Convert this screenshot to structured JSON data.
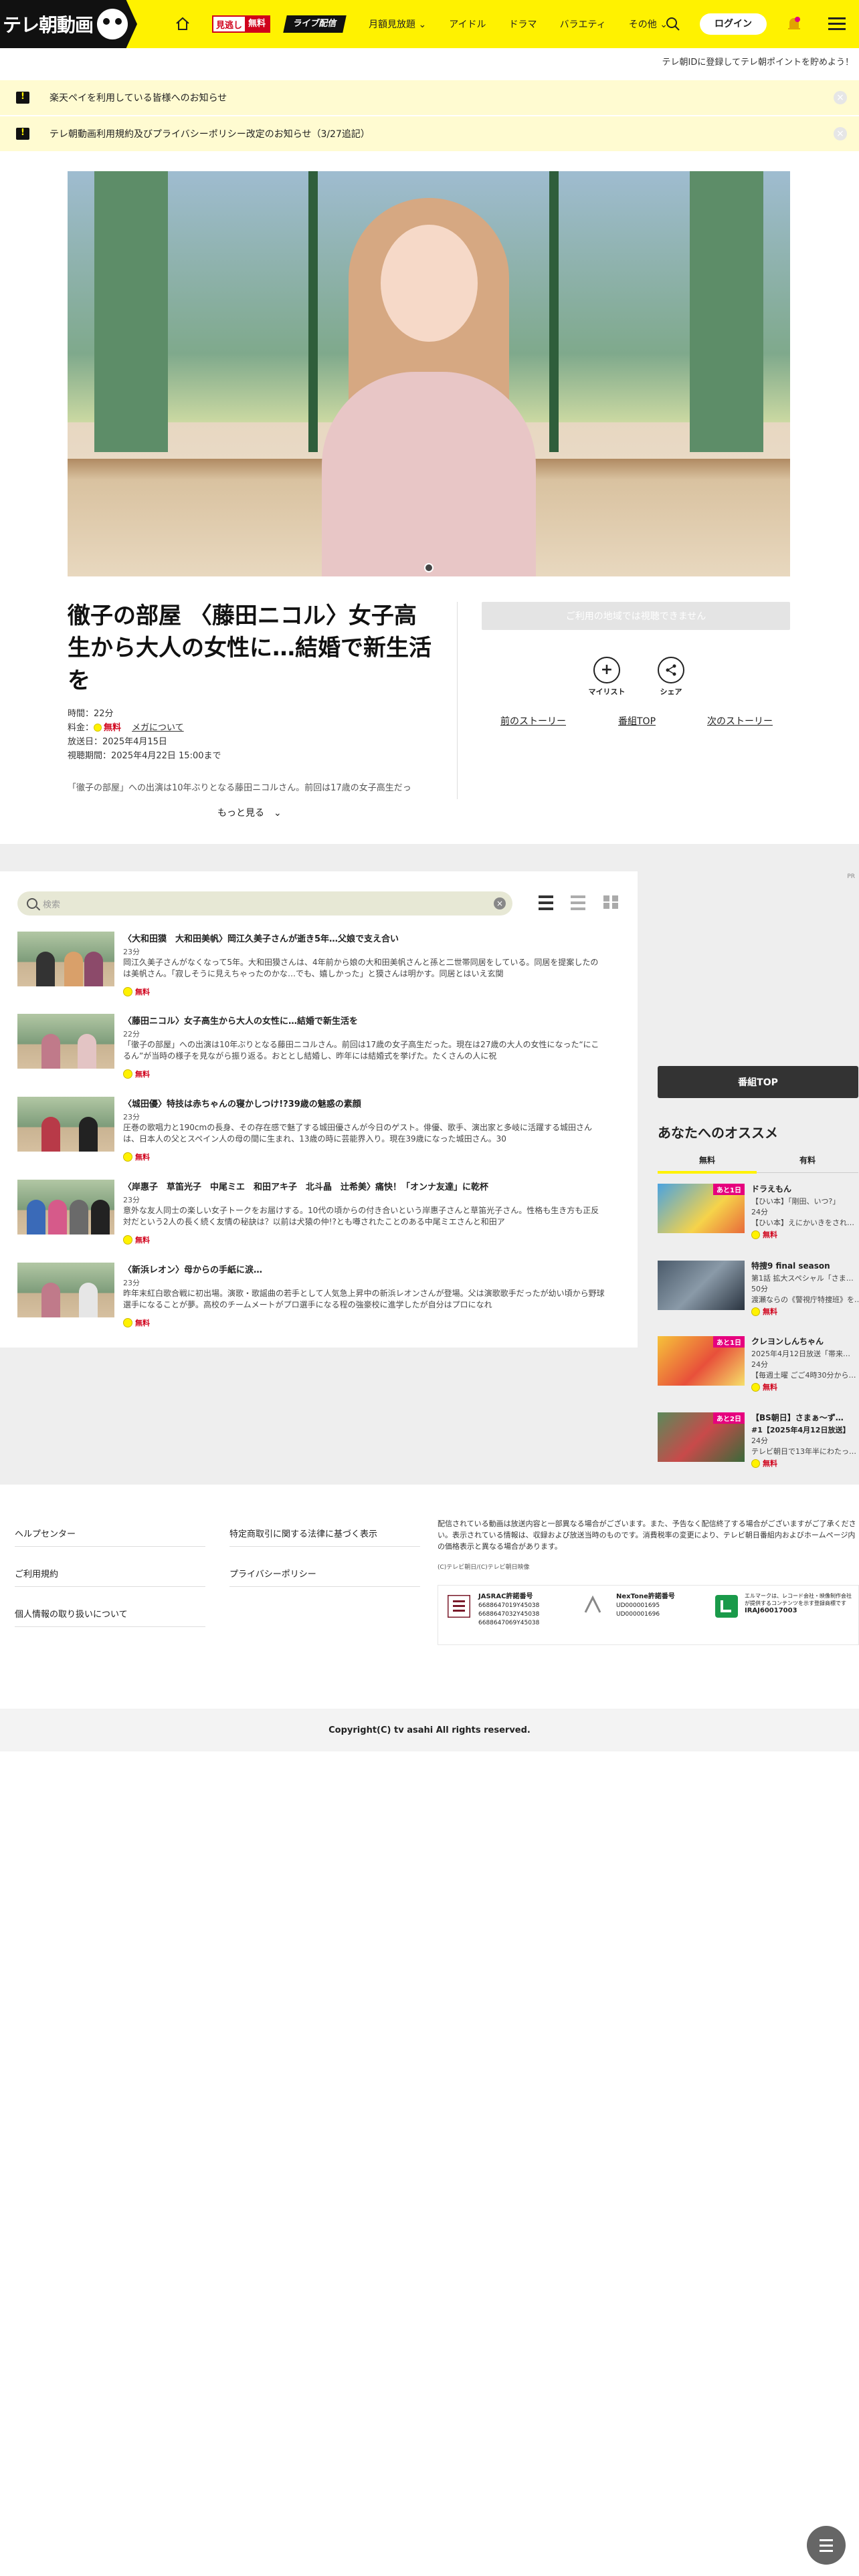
{
  "header": {
    "logo_text": "テレ朝動画",
    "badge_mitoshi": "見逃し",
    "badge_free": "無料",
    "badge_live": "ライブ配信",
    "nav": [
      "月額見放題",
      "アイドル",
      "ドラマ",
      "バラエティ",
      "その他"
    ],
    "login_label": "ログイン",
    "colors": {
      "accent": "#fff200",
      "free": "#d0021b",
      "pink": "#e6007e"
    }
  },
  "promo_text": "テレ朝IDに登録してテレ朝ポイントを貯めよう！",
  "notices": [
    "楽天ペイを利用している皆様へのお知らせ",
    "テレ朝動画利用規約及びプライバシーポリシー改定のお知らせ（3/27追記）"
  ],
  "program": {
    "title": "徹子の部屋 〈藤田ニコル〉女子高生から大人の女性に…結婚で新生活を",
    "duration": "時間：22分",
    "price_label": "料金：",
    "price_value": "無料",
    "menu_link": "メガについて",
    "air_date": "放送日：2025年4月15日",
    "period": "視聴期間：2025年4月22日 15:00まで",
    "description": "「徹子の部屋」への出演は10年ぶりとなる藤田ニコルさん。前回は17歳の女子高生だっ",
    "more_label": "もっと見る",
    "unavailable": "ご利用の地域では視聴できません",
    "mylist_label": "マイリスト",
    "share_label": "シェア",
    "prev_story": "前のストーリー",
    "program_top": "番組TOP",
    "next_story": "次のストーリー"
  },
  "list": {
    "search_placeholder": "検索",
    "episodes": [
      {
        "title": "〈大和田獏　大和田美帆〉岡江久美子さんが逝き5年…父娘で支え合い",
        "duration": "23分",
        "desc": "岡江久美子さんがなくなって5年。大和田獏さんは、4年前から娘の大和田美帆さんと孫と二世帯同居をしている。同居を提案したのは美帆さん。「寂しそうに見えちゃったのかな…でも、嬉しかった」と獏さんは明かす。同居とはいえ玄関",
        "free": "無料"
      },
      {
        "title": "〈藤田ニコル〉女子高生から大人の女性に…結婚で新生活を",
        "duration": "22分",
        "desc": "「徹子の部屋」への出演は10年ぶりとなる藤田ニコルさん。前回は17歳の女子高生だった。現在は27歳の大人の女性になった“にこるん”が当時の様子を見ながら振り返る。おととし結婚し、昨年には結婚式を挙げた。たくさんの人に祝",
        "free": "無料"
      },
      {
        "title": "〈城田優〉特技は赤ちゃんの寝かしつけ!?39歳の魅惑の素顔",
        "duration": "23分",
        "desc": "圧巻の歌唱力と190cmの長身、その存在感で魅了する城田優さんが今日のゲスト。俳優、歌手、演出家と多岐に活躍する城田さんは、日本人の父とスペイン人の母の間に生まれ、13歳の時に芸能界入り。現在39歳になった城田さん。30",
        "free": "無料"
      },
      {
        "title": "〈岸惠子　草笛光子　中尾ミエ　和田アキ子　北斗晶　辻希美〉痛快！「オンナ友達」に乾杯",
        "duration": "23分",
        "desc": "意外な友人同士の楽しい女子トークをお届けする。10代の頃からの付き合いという岸惠子さんと草笛光子さん。性格も生き方も正反対だという2人の長く続く友情の秘訣は？以前は犬猿の仲!?とも噂されたことのある中尾ミエさんと和田ア",
        "free": "無料"
      },
      {
        "title": "〈新浜レオン〉母からの手紙に涙…",
        "duration": "23分",
        "desc": "昨年末紅白歌合戦に初出場。演歌・歌謡曲の若手として人気急上昇中の新浜レオンさんが登場。父は演歌歌手だったが幼い頃から野球選手になることが夢。高校のチームメートがプロ選手になる程の強豪校に進学したが自分はプロになれ",
        "free": "無料"
      }
    ]
  },
  "sidebar": {
    "ad_label": "PR",
    "program_top": "番組TOP",
    "heading": "あなたへのオススメ",
    "tab_free": "無料",
    "tab_paid": "有料",
    "items": [
      {
        "badge": "あと1日",
        "title": "ドラえもん",
        "meta": "【ひい本】「剛田、いつ?」",
        "meta2": "24分",
        "sub": "【ひい本】えにかいきをされ…",
        "free": "無料"
      },
      {
        "badge": "",
        "title": "特捜9 final season",
        "meta": "第1話 拡大スペシャル「さま…",
        "meta2": "50分",
        "sub": "渡瀬ならの《警視庁特捜班》を…",
        "free": "無料"
      },
      {
        "badge": "あと1日",
        "title": "クレヨンしんちゃん",
        "meta": "2025年4月12日放送「帯来…",
        "meta2": "24分",
        "sub": "【毎週土曜 ごご4時30分から…",
        "free": "無料"
      },
      {
        "badge": "あと2日",
        "title": "【BS朝日】さまぁ～ず…",
        "meta": "#1【2025年4月12日放送】",
        "meta2": "24分",
        "sub": "テレビ朝日で13年半にわたっ…",
        "free": "無料"
      }
    ]
  },
  "footer": {
    "links_left": [
      "ヘルプセンター",
      "ご利用規約",
      "個人情報の取り扱いについて"
    ],
    "links_right": [
      "特定商取引に関する法律に基づく表示",
      "プライバシーポリシー"
    ],
    "note": "配信されている動画は放送内容と一部異なる場合がございます。また、予告なく配信終了する場合がございますがご了承ください。表示されている情報は、収録および放送当時のものです。消費税率の変更により、テレビ朝日番組内およびホームページ内の価格表示と異なる場合があります。",
    "copyright_small": "(C)テレビ朝日/(C)テレビ朝日映像",
    "jasrac_title": "JASRAC許諾番号",
    "jasrac_nums": [
      "6688647019Y45038",
      "6688647032Y45038",
      "6688647069Y45038"
    ],
    "nextone_title": "NexTone許諾番号",
    "nextone_nums": [
      "UD000001695",
      "UD000001696"
    ],
    "lmark_text": "エルマークは、レコード会社・映像制作会社が提供するコンテンツを示す登録商標です",
    "lmark_num": "IRAJ60017003",
    "copyright": "Copyright(C) tv asahi All rights reserved."
  }
}
